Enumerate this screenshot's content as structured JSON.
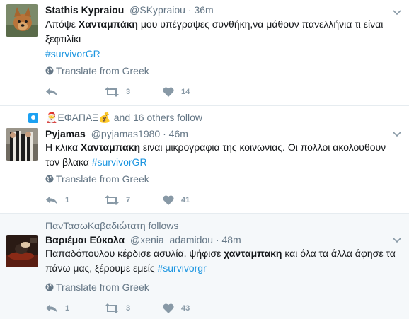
{
  "tweets": [
    {
      "context": null,
      "fullname": "Stathis Kypraiou",
      "handle": "@SKypraiou",
      "separator": "·",
      "time": "36m",
      "text_parts": {
        "p1": "Απόψε ",
        "b1": "Χανταμπάκη",
        "p2": " μου υπέγραψες συνθήκη,να μάθουν πανελλήνια τι είναι ξεφτιλίκι",
        "tag": "#survivorGR"
      },
      "translate_label": "Translate from Greek",
      "reply_count": "",
      "retweet_count": "3",
      "like_count": "14"
    },
    {
      "context": "🎅ΕΦΑΠΑΞ💰 and 16 others follow",
      "fullname": "Pyjamas",
      "handle": "@pyjamas1980",
      "separator": "·",
      "time": "46m",
      "text_parts": {
        "p1": "Η κλικα ",
        "b1": "Χανταμπακη",
        "p2": " ειναι μικρογραφια της κοινωνιας. Οι πολλοι ακολουθουν τον βλακα ",
        "tag": "#survivorGR"
      },
      "translate_label": "Translate from Greek",
      "reply_count": "1",
      "retweet_count": "7",
      "like_count": "41"
    },
    {
      "context": "ΠανΤασωΚαβαδιώτατη follows",
      "fullname": "Βαριέμαι Εύκολα",
      "handle": "@xenia_adamidou",
      "separator": "·",
      "time": "48m",
      "text_parts": {
        "p1": "Παπαδόπουλου κέρδισε ασυλία, ψήφισε ",
        "b1": "χανταμπακη",
        "p2": " και όλα τα άλλα άφησε τα πάνω μας, ξέρουμε εμείς ",
        "tag": "#survivorgr"
      },
      "translate_label": "Translate from Greek",
      "reply_count": "1",
      "retweet_count": "3",
      "like_count": "43"
    }
  ],
  "colors": {
    "link": "#1b95e0",
    "muted": "#657786",
    "action": "#8899a6",
    "context_icon": "#1da1f2",
    "divider": "#e6ecf0",
    "highlight_bg": "#f5f8fa"
  },
  "icons": {
    "reply": "reply-icon",
    "retweet": "retweet-icon",
    "like": "heart-icon",
    "translate": "globe-icon",
    "menu": "chevron-down-icon",
    "context": "follow-context-icon"
  }
}
